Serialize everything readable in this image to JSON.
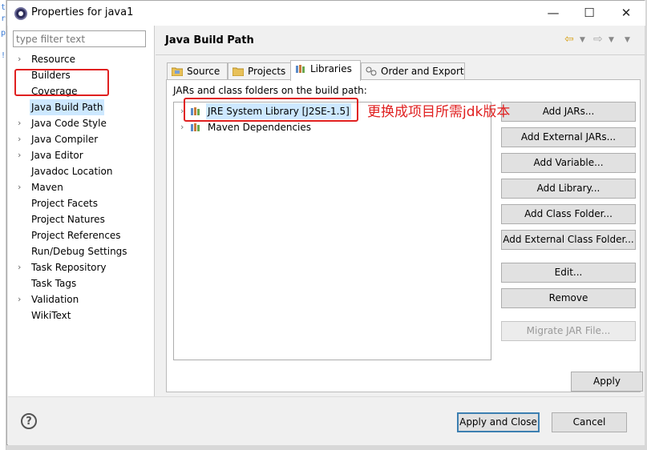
{
  "window": {
    "title": "Properties for java1"
  },
  "filter": {
    "placeholder": "type filter text"
  },
  "sidebar": {
    "items": [
      {
        "label": "Resource",
        "expandable": true
      },
      {
        "label": "Builders",
        "expandable": false
      },
      {
        "label": "Coverage",
        "expandable": false
      },
      {
        "label": "Java Build Path",
        "expandable": false,
        "selected": true
      },
      {
        "label": "Java Code Style",
        "expandable": true
      },
      {
        "label": "Java Compiler",
        "expandable": true
      },
      {
        "label": "Java Editor",
        "expandable": true
      },
      {
        "label": "Javadoc Location",
        "expandable": false
      },
      {
        "label": "Maven",
        "expandable": true
      },
      {
        "label": "Project Facets",
        "expandable": false
      },
      {
        "label": "Project Natures",
        "expandable": false
      },
      {
        "label": "Project References",
        "expandable": false
      },
      {
        "label": "Run/Debug Settings",
        "expandable": false
      },
      {
        "label": "Task Repository",
        "expandable": true
      },
      {
        "label": "Task Tags",
        "expandable": false
      },
      {
        "label": "Validation",
        "expandable": true
      },
      {
        "label": "WikiText",
        "expandable": false
      }
    ]
  },
  "page": {
    "title": "Java Build Path"
  },
  "tabs": [
    {
      "label": "Source",
      "icon": "source-folder-icon"
    },
    {
      "label": "Projects",
      "icon": "projects-folder-icon"
    },
    {
      "label": "Libraries",
      "icon": "libraries-icon",
      "active": true
    },
    {
      "label": "Order and Export",
      "icon": "order-export-icon"
    }
  ],
  "libraries": {
    "label": "JARs and class folders on the build path:",
    "items": [
      {
        "label": "JRE System Library [J2SE-1.5]",
        "selected": true
      },
      {
        "label": "Maven Dependencies",
        "selected": false
      }
    ],
    "annotation": "更换成项目所需jdk版本"
  },
  "buttons": {
    "add_jars": "Add JARs...",
    "add_external_jars": "Add External JARs...",
    "add_variable": "Add Variable...",
    "add_library": "Add Library...",
    "add_class_folder": "Add Class Folder...",
    "add_external_class_folder": "Add External Class Folder...",
    "edit": "Edit...",
    "remove": "Remove",
    "migrate_jar": "Migrate JAR File...",
    "apply": "Apply"
  },
  "dialog": {
    "apply_and_close": "Apply and Close",
    "cancel": "Cancel"
  },
  "colors": {
    "annotation_red": "#e02020",
    "selection": "#cde8ff",
    "default_button_border": "#3c7fb1"
  }
}
